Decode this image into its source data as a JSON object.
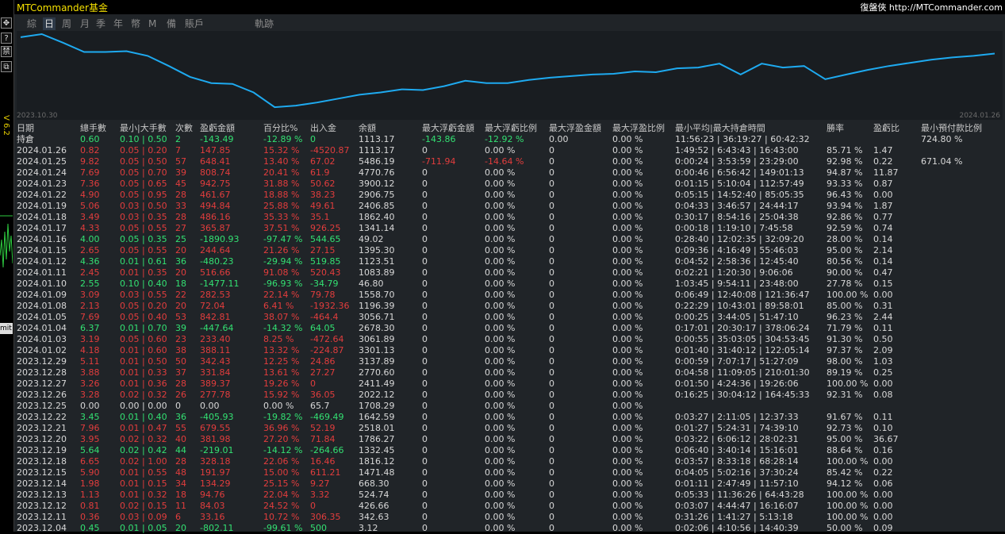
{
  "sidebar": {
    "buttons": [
      "✥",
      "?",
      "禁",
      "⧉"
    ],
    "version": "V 6.2",
    "mit_label": "mit"
  },
  "header": {
    "title": "MTCommander基金",
    "brand": "復盤俠",
    "url": "http://MTCommander.com"
  },
  "tabs": [
    {
      "label": "綜",
      "active": false
    },
    {
      "label": "日",
      "active": true
    },
    {
      "label": "周",
      "active": false
    },
    {
      "label": "月",
      "active": false
    },
    {
      "label": "季",
      "active": false
    },
    {
      "label": "年",
      "active": false
    },
    {
      "label": "幣",
      "active": false
    },
    {
      "label": "M",
      "active": false
    },
    {
      "label": "備",
      "active": false
    },
    {
      "label": "賬戶",
      "active": false
    },
    {
      "label": "軌跡",
      "active": false
    }
  ],
  "equity_chart": {
    "start_date": "2023.10.30",
    "end_date": "2024.01.26",
    "line_color": "#1eaaf0",
    "values": [
      95,
      99,
      88,
      76,
      76,
      77,
      71,
      58,
      44,
      36,
      35,
      24,
      5,
      7,
      11,
      16,
      21,
      24,
      28,
      27,
      32,
      39,
      36,
      36,
      40,
      43,
      45,
      47,
      48,
      51,
      50,
      55,
      56,
      61,
      47,
      61,
      56,
      58,
      41,
      47,
      53,
      58,
      62,
      66,
      69,
      71,
      74
    ]
  },
  "table": {
    "headers": [
      "日期",
      "總手數",
      "最小|大手數",
      "次數",
      "盈虧金額",
      "百分比%",
      "出入金",
      "余額",
      "最大浮虧金額",
      "最大浮虧比例",
      "最大浮盈金額",
      "最大浮盈比例",
      "最小平均|最大持倉時間",
      "勝率",
      "盈虧比",
      "最小預付款比例"
    ],
    "rows": [
      {
        "c": "green",
        "d": "持倉",
        "lots": "0.60",
        "mm": "0.10 | 0.50",
        "n": "2",
        "pnl": "-143.49",
        "pct": "-12.89 %",
        "io": "0",
        "bal": "1113.17",
        "mfl": "-143.86",
        "mflp": "-12.92 %",
        "mfp": "0.00",
        "mfpp": "0.00 %",
        "hold": "11:56:23 | 36:19:27 | 60:42:32",
        "win": "",
        "pr": "",
        "marg": "724.80 %"
      },
      {
        "c": "red",
        "d": "2024.01.26",
        "lots": "0.82",
        "mm": "0.05 | 0.20",
        "n": "7",
        "pnl": "147.85",
        "pct": "15.32 %",
        "io": "-4520.87",
        "bal": "1113.17",
        "mfl": "0",
        "mflp": "0.00 %",
        "mfp": "0",
        "mfpp": "0.00 %",
        "hold": "1:49:52 | 6:43:43 | 16:43:00",
        "win": "85.71 %",
        "pr": "1.47",
        "marg": ""
      },
      {
        "c": "red",
        "d": "2024.01.25",
        "lots": "9.82",
        "mm": "0.05 | 0.50",
        "n": "57",
        "pnl": "648.41",
        "pct": "13.40 %",
        "io": "67.02",
        "bal": "5486.19",
        "mfl": "-711.94",
        "mflp": "-14.64 %",
        "mfp": "0",
        "mfpp": "0.00 %",
        "hold": "0:00:24 | 3:53:59 | 23:29:00",
        "win": "92.98 %",
        "pr": "0.22",
        "marg": "671.04 %"
      },
      {
        "c": "red",
        "d": "2024.01.24",
        "lots": "7.69",
        "mm": "0.05 | 0.70",
        "n": "39",
        "pnl": "808.74",
        "pct": "20.41 %",
        "io": "61.9",
        "bal": "4770.76",
        "mfl": "0",
        "mflp": "0.00 %",
        "mfp": "0",
        "mfpp": "0.00 %",
        "hold": "0:00:46 | 6:56:42 | 149:01:13",
        "win": "94.87 %",
        "pr": "11.87",
        "marg": ""
      },
      {
        "c": "red",
        "d": "2024.01.23",
        "lots": "7.36",
        "mm": "0.05 | 0.65",
        "n": "45",
        "pnl": "942.75",
        "pct": "31.88 %",
        "io": "50.62",
        "bal": "3900.12",
        "mfl": "0",
        "mflp": "0.00 %",
        "mfp": "0",
        "mfpp": "0.00 %",
        "hold": "0:01:15 | 5:10:04 | 112:57:49",
        "win": "93.33 %",
        "pr": "0.87",
        "marg": ""
      },
      {
        "c": "red",
        "d": "2024.01.22",
        "lots": "4.90",
        "mm": "0.05 | 0.95",
        "n": "28",
        "pnl": "461.67",
        "pct": "18.88 %",
        "io": "38.23",
        "bal": "2906.75",
        "mfl": "0",
        "mflp": "0.00 %",
        "mfp": "0",
        "mfpp": "0.00 %",
        "hold": "0:05:15 | 14:52:40 | 85:05:35",
        "win": "96.43 %",
        "pr": "0.00",
        "marg": ""
      },
      {
        "c": "red",
        "d": "2024.01.19",
        "lots": "5.06",
        "mm": "0.03 | 0.50",
        "n": "33",
        "pnl": "494.84",
        "pct": "25.88 %",
        "io": "49.61",
        "bal": "2406.85",
        "mfl": "0",
        "mflp": "0.00 %",
        "mfp": "0",
        "mfpp": "0.00 %",
        "hold": "0:04:33 | 3:46:57 | 24:44:17",
        "win": "93.94 %",
        "pr": "1.87",
        "marg": ""
      },
      {
        "c": "red",
        "d": "2024.01.18",
        "lots": "3.49",
        "mm": "0.03 | 0.35",
        "n": "28",
        "pnl": "486.16",
        "pct": "35.33 %",
        "io": "35.1",
        "bal": "1862.40",
        "mfl": "0",
        "mflp": "0.00 %",
        "mfp": "0",
        "mfpp": "0.00 %",
        "hold": "0:30:17 | 8:54:16 | 25:04:38",
        "win": "92.86 %",
        "pr": "0.77",
        "marg": ""
      },
      {
        "c": "red",
        "d": "2024.01.17",
        "lots": "4.33",
        "mm": "0.05 | 0.55",
        "n": "27",
        "pnl": "365.87",
        "pct": "37.51 %",
        "io": "926.25",
        "bal": "1341.14",
        "mfl": "0",
        "mflp": "0.00 %",
        "mfp": "0",
        "mfpp": "0.00 %",
        "hold": "0:00:18 | 1:19:10 | 7:45:58",
        "win": "92.59 %",
        "pr": "0.74",
        "marg": ""
      },
      {
        "c": "green",
        "d": "2024.01.16",
        "lots": "4.00",
        "mm": "0.05 | 0.35",
        "n": "25",
        "pnl": "-1890.93",
        "pct": "-97.47 %",
        "io": "544.65",
        "bal": "49.02",
        "mfl": "0",
        "mflp": "0.00 %",
        "mfp": "0",
        "mfpp": "0.00 %",
        "hold": "0:28:40 | 12:02:35 | 32:09:20",
        "win": "28.00 %",
        "pr": "0.14",
        "marg": ""
      },
      {
        "c": "red",
        "d": "2024.01.15",
        "lots": "2.65",
        "mm": "0.05 | 0.55",
        "n": "20",
        "pnl": "244.64",
        "pct": "21.26 %",
        "io": "27.15",
        "bal": "1395.30",
        "mfl": "0",
        "mflp": "0.00 %",
        "mfp": "0",
        "mfpp": "0.00 %",
        "hold": "0:09:36 | 4:16:49 | 55:46:03",
        "win": "95.00 %",
        "pr": "2.14",
        "marg": ""
      },
      {
        "c": "green",
        "d": "2024.01.12",
        "lots": "4.36",
        "mm": "0.01 | 0.61",
        "n": "36",
        "pnl": "-480.23",
        "pct": "-29.94 %",
        "io": "519.85",
        "bal": "1123.51",
        "mfl": "0",
        "mflp": "0.00 %",
        "mfp": "0",
        "mfpp": "0.00 %",
        "hold": "0:04:52 | 2:58:36 | 12:45:40",
        "win": "80.56 %",
        "pr": "0.14",
        "marg": ""
      },
      {
        "c": "red",
        "d": "2024.01.11",
        "lots": "2.45",
        "mm": "0.01 | 0.35",
        "n": "20",
        "pnl": "516.66",
        "pct": "91.08 %",
        "io": "520.43",
        "bal": "1083.89",
        "mfl": "0",
        "mflp": "0.00 %",
        "mfp": "0",
        "mfpp": "0.00 %",
        "hold": "0:02:21 | 1:20:30 | 9:06:06",
        "win": "90.00 %",
        "pr": "0.47",
        "marg": ""
      },
      {
        "c": "green",
        "d": "2024.01.10",
        "lots": "2.55",
        "mm": "0.10 | 0.40",
        "n": "18",
        "pnl": "-1477.11",
        "pct": "-96.93 %",
        "io": "-34.79",
        "bal": "46.80",
        "mfl": "0",
        "mflp": "0.00 %",
        "mfp": "0",
        "mfpp": "0.00 %",
        "hold": "1:03:45 | 9:54:11 | 23:48:00",
        "win": "27.78 %",
        "pr": "0.15",
        "marg": ""
      },
      {
        "c": "red",
        "d": "2024.01.09",
        "lots": "3.09",
        "mm": "0.03 | 0.55",
        "n": "22",
        "pnl": "282.53",
        "pct": "22.14 %",
        "io": "79.78",
        "bal": "1558.70",
        "mfl": "0",
        "mflp": "0.00 %",
        "mfp": "0",
        "mfpp": "0.00 %",
        "hold": "0:06:49 | 12:40:08 | 121:36:47",
        "win": "100.00 %",
        "pr": "0.00",
        "marg": ""
      },
      {
        "c": "red",
        "d": "2024.01.08",
        "lots": "2.13",
        "mm": "0.05 | 0.20",
        "n": "20",
        "pnl": "72.04",
        "pct": "6.41 %",
        "io": "-1932.36",
        "bal": "1196.39",
        "mfl": "0",
        "mflp": "0.00 %",
        "mfp": "0",
        "mfpp": "0.00 %",
        "hold": "0:22:29 | 10:43:01 | 89:58:01",
        "win": "85.00 %",
        "pr": "0.31",
        "marg": ""
      },
      {
        "c": "red",
        "d": "2024.01.05",
        "lots": "7.69",
        "mm": "0.05 | 0.40",
        "n": "53",
        "pnl": "842.81",
        "pct": "38.07 %",
        "io": "-464.4",
        "bal": "3056.71",
        "mfl": "0",
        "mflp": "0.00 %",
        "mfp": "0",
        "mfpp": "0.00 %",
        "hold": "0:00:25 | 3:44:05 | 51:47:10",
        "win": "96.23 %",
        "pr": "2.44",
        "marg": ""
      },
      {
        "c": "green",
        "d": "2024.01.04",
        "lots": "6.37",
        "mm": "0.01 | 0.70",
        "n": "39",
        "pnl": "-447.64",
        "pct": "-14.32 %",
        "io": "64.05",
        "bal": "2678.30",
        "mfl": "0",
        "mflp": "0.00 %",
        "mfp": "0",
        "mfpp": "0.00 %",
        "hold": "0:17:01 | 20:30:17 | 378:06:24",
        "win": "71.79 %",
        "pr": "0.11",
        "marg": ""
      },
      {
        "c": "red",
        "d": "2024.01.03",
        "lots": "3.19",
        "mm": "0.05 | 0.60",
        "n": "23",
        "pnl": "233.40",
        "pct": "8.25 %",
        "io": "-472.64",
        "bal": "3061.89",
        "mfl": "0",
        "mflp": "0.00 %",
        "mfp": "0",
        "mfpp": "0.00 %",
        "hold": "0:00:55 | 35:03:05 | 304:53:45",
        "win": "91.30 %",
        "pr": "0.50",
        "marg": ""
      },
      {
        "c": "red",
        "d": "2024.01.02",
        "lots": "4.18",
        "mm": "0.01 | 0.60",
        "n": "38",
        "pnl": "388.11",
        "pct": "13.32 %",
        "io": "-224.87",
        "bal": "3301.13",
        "mfl": "0",
        "mflp": "0.00 %",
        "mfp": "0",
        "mfpp": "0.00 %",
        "hold": "0:01:40 | 31:40:12 | 122:05:14",
        "win": "97.37 %",
        "pr": "2.09",
        "marg": ""
      },
      {
        "c": "red",
        "d": "2023.12.29",
        "lots": "5.11",
        "mm": "0.01 | 0.50",
        "n": "50",
        "pnl": "342.43",
        "pct": "12.25 %",
        "io": "24.86",
        "bal": "3137.89",
        "mfl": "0",
        "mflp": "0.00 %",
        "mfp": "0",
        "mfpp": "0.00 %",
        "hold": "0:00:59 | 7:07:17 | 51:27:09",
        "win": "98.00 %",
        "pr": "1.03",
        "marg": ""
      },
      {
        "c": "red",
        "d": "2023.12.28",
        "lots": "3.88",
        "mm": "0.01 | 0.33",
        "n": "37",
        "pnl": "331.84",
        "pct": "13.61 %",
        "io": "27.27",
        "bal": "2770.60",
        "mfl": "0",
        "mflp": "0.00 %",
        "mfp": "0",
        "mfpp": "0.00 %",
        "hold": "0:04:58 | 11:09:05 | 210:01:30",
        "win": "89.19 %",
        "pr": "0.25",
        "marg": ""
      },
      {
        "c": "red",
        "d": "2023.12.27",
        "lots": "3.26",
        "mm": "0.01 | 0.36",
        "n": "28",
        "pnl": "389.37",
        "pct": "19.26 %",
        "io": "0",
        "bal": "2411.49",
        "mfl": "0",
        "mflp": "0.00 %",
        "mfp": "0",
        "mfpp": "0.00 %",
        "hold": "0:01:50 | 4:24:36 | 19:26:06",
        "win": "100.00 %",
        "pr": "0.00",
        "marg": ""
      },
      {
        "c": "red",
        "d": "2023.12.26",
        "lots": "3.28",
        "mm": "0.02 | 0.32",
        "n": "26",
        "pnl": "277.78",
        "pct": "15.92 %",
        "io": "36.05",
        "bal": "2022.12",
        "mfl": "0",
        "mflp": "0.00 %",
        "mfp": "0",
        "mfpp": "0.00 %",
        "hold": "0:16:25 | 30:04:12 | 164:45:33",
        "win": "92.31 %",
        "pr": "0.08",
        "marg": ""
      },
      {
        "c": "white",
        "d": "2023.12.25",
        "lots": "0.00",
        "mm": "0.00 | 0.00",
        "n": "0",
        "pnl": "0.00",
        "pct": "0.00 %",
        "io": "65.7",
        "bal": "1708.29",
        "mfl": "0",
        "mflp": "0.00 %",
        "mfp": "0",
        "mfpp": "0.00 %",
        "hold": "",
        "win": "",
        "pr": "",
        "marg": ""
      },
      {
        "c": "green",
        "d": "2023.12.22",
        "lots": "3.45",
        "mm": "0.01 | 0.40",
        "n": "36",
        "pnl": "-405.93",
        "pct": "-19.82 %",
        "io": "-469.49",
        "bal": "1642.59",
        "mfl": "0",
        "mflp": "0.00 %",
        "mfp": "0",
        "mfpp": "0.00 %",
        "hold": "0:03:27 | 2:11:05 | 12:37:33",
        "win": "91.67 %",
        "pr": "0.11",
        "marg": ""
      },
      {
        "c": "red",
        "d": "2023.12.21",
        "lots": "7.96",
        "mm": "0.01 | 0.47",
        "n": "55",
        "pnl": "679.55",
        "pct": "36.96 %",
        "io": "52.19",
        "bal": "2518.01",
        "mfl": "0",
        "mflp": "0.00 %",
        "mfp": "0",
        "mfpp": "0.00 %",
        "hold": "0:01:27 | 5:24:31 | 74:39:10",
        "win": "92.73 %",
        "pr": "0.10",
        "marg": ""
      },
      {
        "c": "red",
        "d": "2023.12.20",
        "lots": "3.95",
        "mm": "0.02 | 0.32",
        "n": "40",
        "pnl": "381.98",
        "pct": "27.20 %",
        "io": "71.84",
        "bal": "1786.27",
        "mfl": "0",
        "mflp": "0.00 %",
        "mfp": "0",
        "mfpp": "0.00 %",
        "hold": "0:03:22 | 6:06:12 | 28:02:31",
        "win": "95.00 %",
        "pr": "36.67",
        "marg": ""
      },
      {
        "c": "green",
        "d": "2023.12.19",
        "lots": "5.64",
        "mm": "0.02 | 0.42",
        "n": "44",
        "pnl": "-219.01",
        "pct": "-14.12 %",
        "io": "-264.66",
        "bal": "1332.45",
        "mfl": "0",
        "mflp": "0.00 %",
        "mfp": "0",
        "mfpp": "0.00 %",
        "hold": "0:06:40 | 3:40:14 | 15:16:01",
        "win": "88.64 %",
        "pr": "0.16",
        "marg": ""
      },
      {
        "c": "red",
        "d": "2023.12.18",
        "lots": "6.65",
        "mm": "0.02 | 1.00",
        "n": "28",
        "pnl": "328.18",
        "pct": "22.06 %",
        "io": "16.46",
        "bal": "1816.12",
        "mfl": "0",
        "mflp": "0.00 %",
        "mfp": "0",
        "mfpp": "0.00 %",
        "hold": "0:03:57 | 8:33:18 | 68:28:14",
        "win": "100.00 %",
        "pr": "0.00",
        "marg": ""
      },
      {
        "c": "red",
        "d": "2023.12.15",
        "lots": "5.90",
        "mm": "0.01 | 0.55",
        "n": "48",
        "pnl": "191.97",
        "pct": "15.00 %",
        "io": "611.21",
        "bal": "1471.48",
        "mfl": "0",
        "mflp": "0.00 %",
        "mfp": "0",
        "mfpp": "0.00 %",
        "hold": "0:04:05 | 5:02:16 | 37:30:24",
        "win": "85.42 %",
        "pr": "0.22",
        "marg": ""
      },
      {
        "c": "red",
        "d": "2023.12.14",
        "lots": "1.98",
        "mm": "0.01 | 0.15",
        "n": "34",
        "pnl": "134.29",
        "pct": "25.15 %",
        "io": "9.27",
        "bal": "668.30",
        "mfl": "0",
        "mflp": "0.00 %",
        "mfp": "0",
        "mfpp": "0.00 %",
        "hold": "0:01:11 | 2:47:49 | 11:57:10",
        "win": "94.12 %",
        "pr": "0.06",
        "marg": ""
      },
      {
        "c": "red",
        "d": "2023.12.13",
        "lots": "1.13",
        "mm": "0.01 | 0.32",
        "n": "18",
        "pnl": "94.76",
        "pct": "22.04 %",
        "io": "3.32",
        "bal": "524.74",
        "mfl": "0",
        "mflp": "0.00 %",
        "mfp": "0",
        "mfpp": "0.00 %",
        "hold": "0:05:33 | 11:36:26 | 64:43:28",
        "win": "100.00 %",
        "pr": "0.00",
        "marg": ""
      },
      {
        "c": "red",
        "d": "2023.12.12",
        "lots": "0.81",
        "mm": "0.02 | 0.15",
        "n": "11",
        "pnl": "84.03",
        "pct": "24.52 %",
        "io": "0",
        "bal": "426.66",
        "mfl": "0",
        "mflp": "0.00 %",
        "mfp": "0",
        "mfpp": "0.00 %",
        "hold": "0:03:07 | 4:44:47 | 16:16:07",
        "win": "100.00 %",
        "pr": "0.00",
        "marg": ""
      },
      {
        "c": "red",
        "d": "2023.12.11",
        "lots": "0.36",
        "mm": "0.03 | 0.09",
        "n": "6",
        "pnl": "33.16",
        "pct": "10.72 %",
        "io": "306.35",
        "bal": "342.63",
        "mfl": "0",
        "mflp": "0.00 %",
        "mfp": "0",
        "mfpp": "0.00 %",
        "hold": "0:31:26 | 1:41:27 | 5:13:18",
        "win": "100.00 %",
        "pr": "0.00",
        "marg": ""
      },
      {
        "c": "green",
        "d": "2023.12.04",
        "lots": "0.45",
        "mm": "0.01 | 0.05",
        "n": "20",
        "pnl": "-802.11",
        "pct": "-99.61 %",
        "io": "500",
        "bal": "3.12",
        "mfl": "0",
        "mflp": "0.00 %",
        "mfp": "0",
        "mfpp": "0.00 %",
        "hold": "0:02:06 | 4:10:56 | 14:40:39",
        "win": "50.00 %",
        "pr": "0.09",
        "marg": ""
      }
    ]
  }
}
